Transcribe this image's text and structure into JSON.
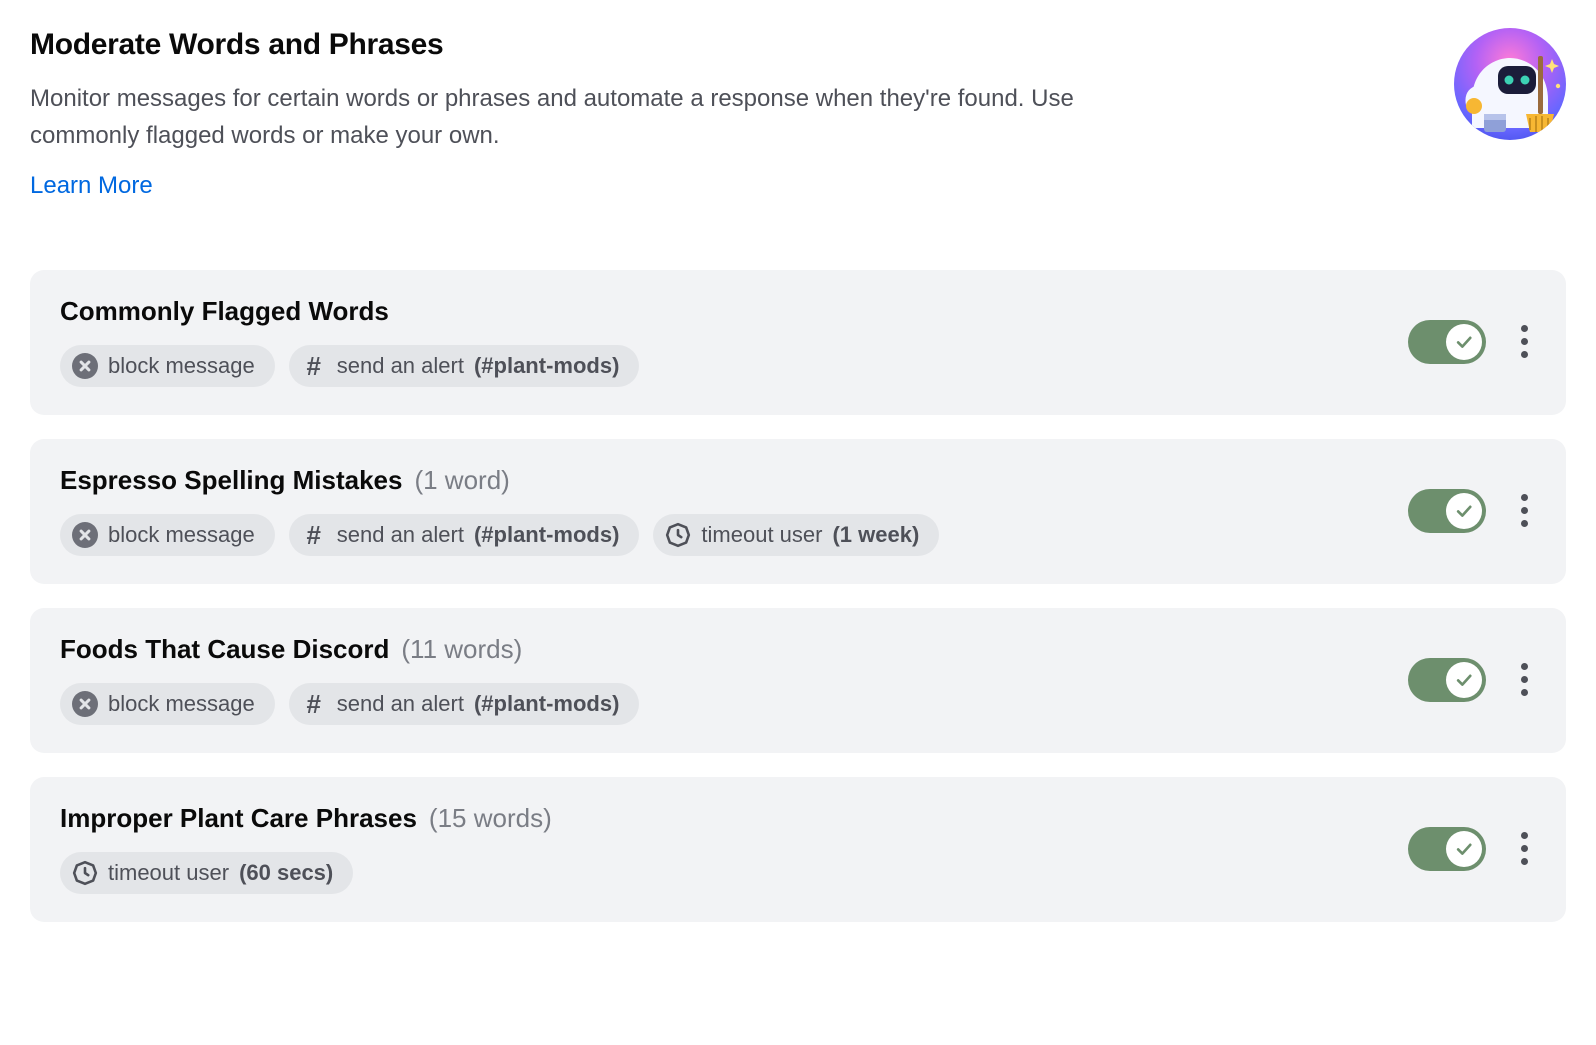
{
  "header": {
    "title": "Moderate Words and Phrases",
    "description": "Monitor messages for certain words or phrases and automate a response when they're found. Use commonly flagged words or make your own.",
    "learn_more": "Learn More"
  },
  "colors": {
    "card_bg": "#f2f3f5",
    "chip_bg": "#e3e5e8",
    "toggle_on": "#6d8f6d",
    "link": "#0068e0"
  },
  "rules": [
    {
      "title": "Commonly Flagged Words",
      "meta": "",
      "enabled": true,
      "actions": [
        {
          "icon": "x-circle",
          "label": "block message",
          "detail": ""
        },
        {
          "icon": "hash",
          "label": "send an alert",
          "detail": "(#plant-mods)"
        }
      ]
    },
    {
      "title": "Espresso Spelling Mistakes",
      "meta": "(1 word)",
      "enabled": true,
      "actions": [
        {
          "icon": "x-circle",
          "label": "block message",
          "detail": ""
        },
        {
          "icon": "hash",
          "label": "send an alert",
          "detail": "(#plant-mods)"
        },
        {
          "icon": "clock",
          "label": "timeout user",
          "detail": "(1 week)"
        }
      ]
    },
    {
      "title": "Foods That Cause Discord",
      "meta": "(11 words)",
      "enabled": true,
      "actions": [
        {
          "icon": "x-circle",
          "label": "block message",
          "detail": ""
        },
        {
          "icon": "hash",
          "label": "send an alert",
          "detail": "(#plant-mods)"
        }
      ]
    },
    {
      "title": "Improper Plant Care Phrases",
      "meta": "(15 words)",
      "enabled": true,
      "actions": [
        {
          "icon": "clock",
          "label": "timeout user",
          "detail": "(60 secs)"
        }
      ]
    }
  ]
}
